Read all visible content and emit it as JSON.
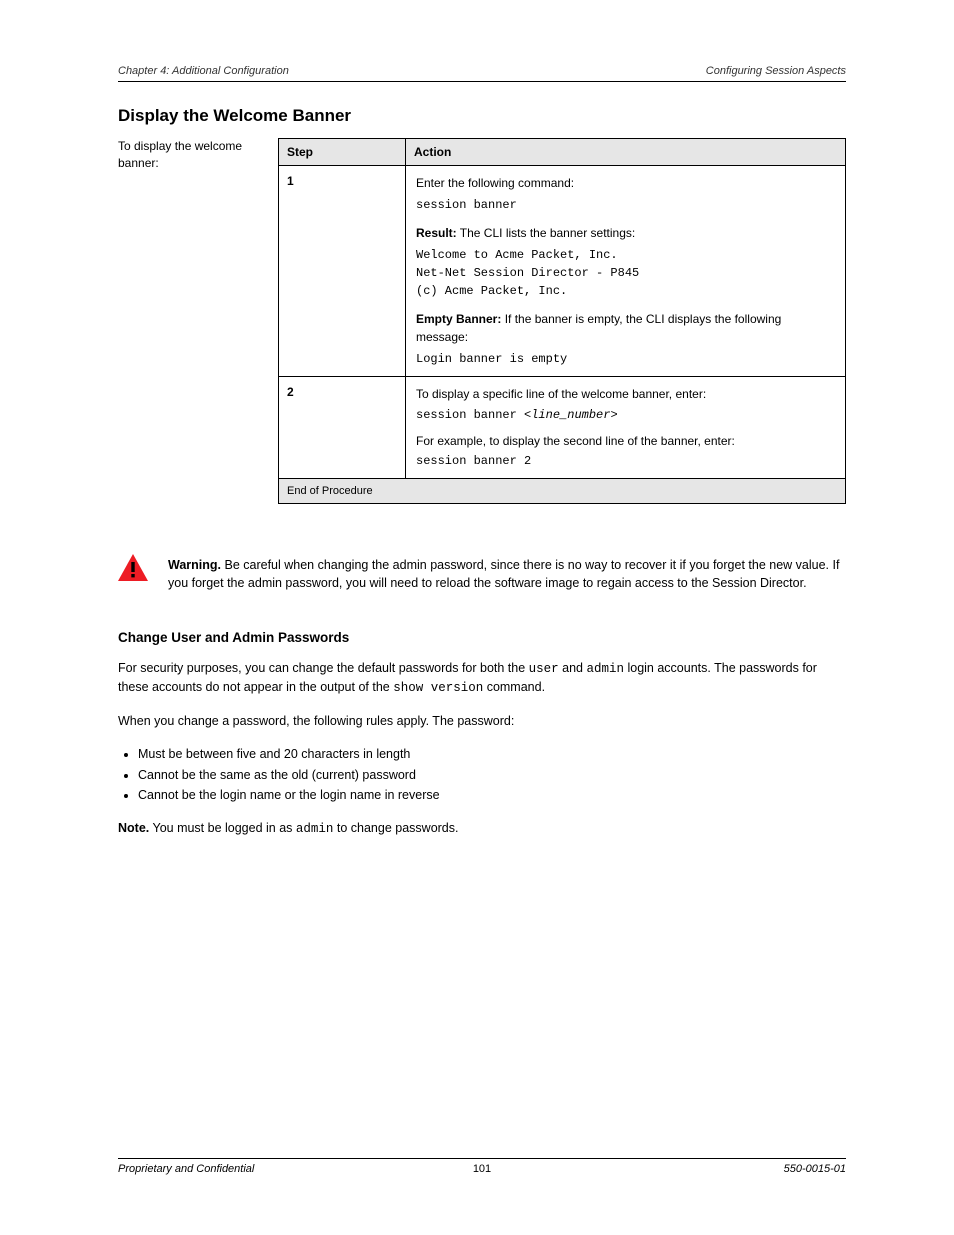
{
  "header": {
    "left": "Chapter 4: Additional Configuration",
    "right": "Configuring Session Aspects"
  },
  "section_heading": "Display the Welcome Banner",
  "intro": "To display the welcome banner:",
  "table": {
    "head": {
      "step": "Step",
      "action": "Action"
    },
    "rows": [
      {
        "step": "1",
        "action_intro": "Enter the following command:",
        "command": "session banner",
        "result_label": "Result:",
        "result_lines": [
          "The CLI lists the banner settings:",
          "Welcome to Acme Packet, Inc.",
          "Net-Net Session Director - P845",
          "(c) Acme Packet, Inc."
        ],
        "empty_label": "Empty Banner:",
        "empty_text": "If the banner is empty, the CLI displays the following message:",
        "empty_msg": "Login banner is empty"
      },
      {
        "step": "2",
        "action_lines": [
          "To display a specific line of the welcome banner, enter:",
          {
            "cmd": "session banner ",
            "arg": "<line_number>"
          },
          "For example, to display the second line of the banner, enter:",
          {
            "cmd": "session banner 2"
          }
        ]
      }
    ],
    "foot": "End of Procedure"
  },
  "warning": {
    "label": "Warning.",
    "text": "Be careful when changing the admin password, since there is no way to recover it if you forget the new value. If you forget the admin password, you will need to reload the software image to regain access to the Session Director."
  },
  "passwords": {
    "heading": "Change User and Admin Passwords",
    "p1_a": "For security purposes, you can change the default passwords for both the ",
    "p1_user": "user",
    "p1_b": " and ",
    "p1_admin": "admin",
    "p1_c": " login accounts. The passwords for these accounts do not appear in the output of the ",
    "p1_cmd": "show version",
    "p1_d": " command.",
    "p2": "When you change a password, the following rules apply. The password:",
    "bullets": [
      "Must be between five and 20 characters in length",
      "Cannot be the same as the old (current) password",
      "Cannot be the login name or the login name in reverse"
    ],
    "note_label": "Note.",
    "note_a": "You must be logged in as ",
    "note_admin": "admin",
    "note_b": " to change passwords."
  },
  "footer": {
    "left": "Proprietary and Confidential",
    "center": "101",
    "right": "550-0015-01"
  }
}
